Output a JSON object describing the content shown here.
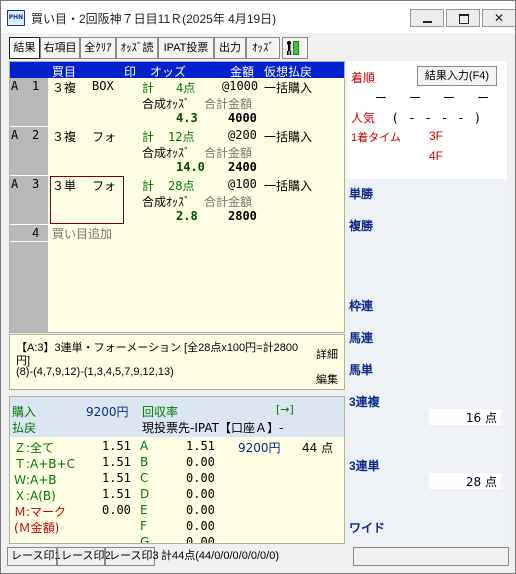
{
  "window": {
    "title": "買い目・2回阪神７日目11Ｒ(2025年 4月19日)",
    "icon_text": "PHN"
  },
  "toolbar": [
    "結果",
    "右項目",
    "全ｸﾘｱ",
    "ｵｯｽﾞ読",
    "IPAT投票",
    "出力",
    "ｵｯｽﾞ"
  ],
  "grid": {
    "headers": {
      "katame": "買目",
      "shirushi": "印",
      "odds": "オッズ",
      "kingaku": "金額",
      "kasou": "仮想払戻"
    },
    "rows": [
      {
        "group": "A",
        "no": "1",
        "type": "３複",
        "mode": "BOX",
        "count_label": "計",
        "count": "4点",
        "unit": "@1000",
        "action": "一括購入",
        "synth_odds_label": "合成ｵｯｽﾞ",
        "total_label": "合計金額",
        "synth_odds": "4.3",
        "total": "4000"
      },
      {
        "group": "A",
        "no": "2",
        "type": "３複",
        "mode": "フォ",
        "count_label": "計",
        "count": "12点",
        "unit": "@200",
        "action": "一括購入",
        "synth_odds_label": "合成ｵｯｽﾞ",
        "total_label": "合計金額",
        "synth_odds": "14.0",
        "total": "2400"
      },
      {
        "group": "A",
        "no": "3",
        "type": "３単",
        "mode": "フォ",
        "count_label": "計",
        "count": "28点",
        "unit": "@100",
        "action": "一括購入",
        "synth_odds_label": "合成ｵｯｽﾞ",
        "total_label": "合計金額",
        "synth_odds": "2.8",
        "total": "2800"
      }
    ],
    "add_row": {
      "no": "4",
      "label": "買い目追加"
    }
  },
  "info": {
    "line1": "【A:3】3連単・フォーメーション [全28点x100円=計2800",
    "line2": "円]",
    "line3": "(8)-(4,7,9,12)-(1,3,4,5,7,9,12,13)",
    "detail_button": "詳細",
    "edit_button": "編集"
  },
  "stats": {
    "purchase_label": "購入",
    "purchase_value": "9200円",
    "return_rate_label": "回収率",
    "arrow": "[→]",
    "payout_label": "払戻",
    "destination": "現投票先-IPAT【口座Ａ】-",
    "rows": [
      {
        "label": "Ｚ:全て",
        "value": "1.51",
        "letter": "A",
        "letter_value": "1.51",
        "extra": "9200円",
        "extra2": "44 点"
      },
      {
        "label": "Ｔ:A+B+C",
        "value": "1.51",
        "letter": "B",
        "letter_value": "0.00"
      },
      {
        "label": "Ｗ:A+B",
        "value": "1.51",
        "letter": "C",
        "letter_value": "0.00"
      },
      {
        "label": "Ｘ:A(B)",
        "value": "1.51",
        "letter": "D",
        "letter_value": "0.00"
      },
      {
        "label": "Ｍ:マーク",
        "value": "0.00",
        "letter": "E",
        "letter_value": "0.00"
      },
      {
        "label": "(Ｍ金額)",
        "value": "",
        "letter": "F",
        "letter_value": "0.00"
      },
      {
        "label": "",
        "value": "",
        "letter": "G",
        "letter_value": "0.00"
      }
    ]
  },
  "right": {
    "order_label": "着順",
    "result_button": "結果入力(F4)",
    "dashes": [
      "ー",
      "ー",
      "ー",
      "ー"
    ],
    "popularity_label": "人気",
    "popularity_value": "(　-　-　-　-　)",
    "first_time_label": "1着タイム",
    "f3_label": "3F",
    "f4_label": "4F",
    "tansho": "単勝",
    "fukusho": "複勝",
    "wakuren": "枠連",
    "umaren": "馬連",
    "umatan": "馬単",
    "sanrenpuku": "3連複",
    "sanrenpuku_count": "16 点",
    "sanrentan": "3連単",
    "sanrentan_count": "28 点",
    "wide": "ワイド"
  },
  "statusbar": {
    "print1": "レース印1",
    "print2": "レース印2",
    "print3": "レース印3",
    "summary": "計44点(44/0/0/0/0/0/0/0)"
  }
}
